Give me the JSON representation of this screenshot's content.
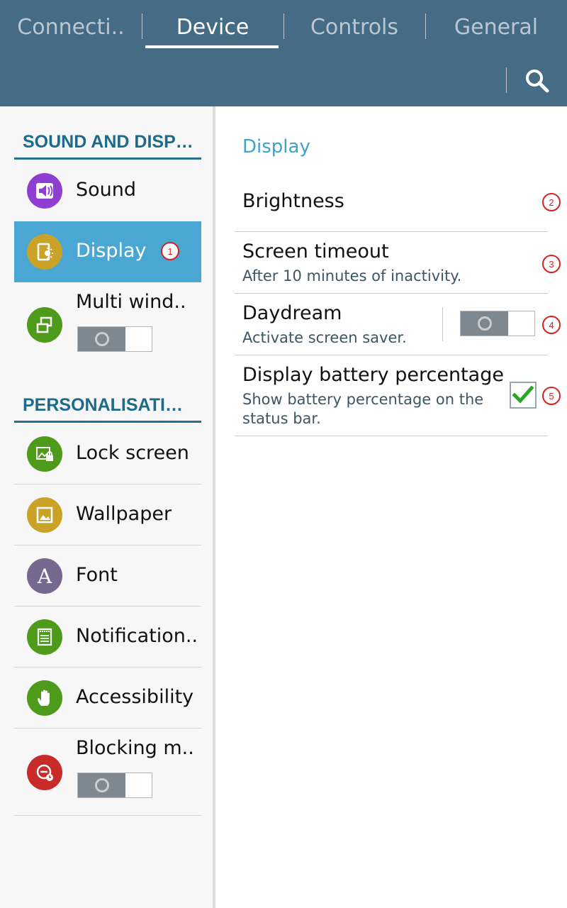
{
  "tabs": [
    {
      "label": "Connecti..",
      "active": false
    },
    {
      "label": "Device",
      "active": true
    },
    {
      "label": "Controls",
      "active": false
    },
    {
      "label": "General",
      "active": false
    }
  ],
  "header": {
    "search_icon": "search-icon"
  },
  "left_pane": {
    "sections": [
      {
        "title": "SOUND AND DISP…",
        "items": [
          {
            "label": "Sound",
            "icon": "speaker-icon",
            "icon_color": "#8e3fd1",
            "selected": false
          },
          {
            "label": "Display",
            "icon": "display-brightness-icon",
            "icon_color": "#c9a227",
            "selected": true,
            "badge": "1"
          },
          {
            "label": "Multi wind..",
            "icon": "multi-window-icon",
            "icon_color": "#4e9a1a",
            "selected": false,
            "toggle": "off"
          }
        ]
      },
      {
        "title": "PERSONALISATI…",
        "items": [
          {
            "label": "Lock screen",
            "icon": "lock-screen-icon",
            "icon_color": "#4e9a1a"
          },
          {
            "label": "Wallpaper",
            "icon": "wallpaper-icon",
            "icon_color": "#c9a227"
          },
          {
            "label": "Font",
            "icon": "font-icon",
            "icon_color": "#77688f",
            "glyph": "A"
          },
          {
            "label": "Notification..",
            "icon": "notification-panel-icon",
            "icon_color": "#4e9a1a"
          },
          {
            "label": "Accessibility",
            "icon": "hand-icon",
            "icon_color": "#4e9a1a"
          },
          {
            "label": "Blocking m..",
            "icon": "blocking-mode-icon",
            "icon_color": "#c92b2b",
            "toggle": "off"
          }
        ]
      }
    ]
  },
  "detail": {
    "title": "Display",
    "settings": [
      {
        "title": "Brightness",
        "badge": "2"
      },
      {
        "title": "Screen timeout",
        "subtitle": "After 10 minutes of inactivity.",
        "badge": "3"
      },
      {
        "title": "Daydream",
        "subtitle": "Activate screen saver.",
        "toggle": "off",
        "badge": "4"
      },
      {
        "title": "Display battery percentage",
        "subtitle_line1": "Show battery percentage on the",
        "subtitle_line2": "status bar.",
        "checked": true,
        "badge": "5"
      }
    ]
  },
  "colors": {
    "header_bg": "#456b85",
    "accent": "#3ea3cc",
    "selected_bg": "#4aa6d3",
    "check": "#2aa52a",
    "badge": "#d32424"
  }
}
